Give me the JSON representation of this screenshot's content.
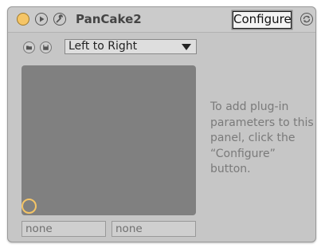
{
  "device": {
    "title": "PanCake2",
    "configure_label": "Configure",
    "power_color": "#f5c566"
  },
  "icons": {
    "power": "power-toggle-icon",
    "play": "play-icon",
    "wrench": "wrench-icon",
    "refresh": "refresh-icon",
    "folder": "folder-open-icon",
    "save": "save-icon"
  },
  "controls": {
    "direction_select": "Left to Right"
  },
  "xy_pad": {
    "x_param": "none",
    "y_param": "none"
  },
  "hint": {
    "text": "To add plug-in parameters to this panel, click the “Configure” button."
  }
}
